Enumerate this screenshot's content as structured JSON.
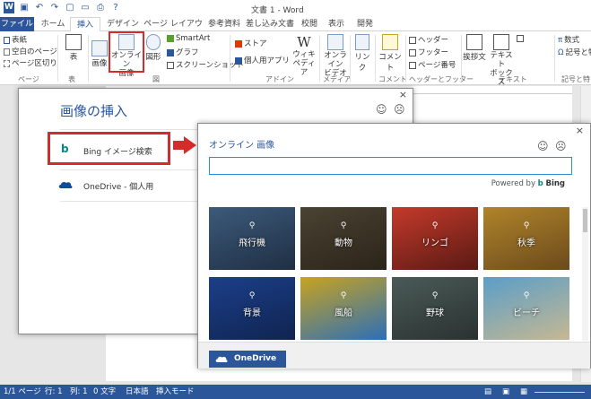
{
  "window": {
    "title": "文書 1 - Word"
  },
  "ribbon_tabs": [
    {
      "label": "ファイル",
      "state": "file"
    },
    {
      "label": "ホーム"
    },
    {
      "label": "挿入",
      "state": "active"
    },
    {
      "label": "デザイン"
    },
    {
      "label": "ページ レイアウト"
    },
    {
      "label": "参考資料"
    },
    {
      "label": "差し込み文書"
    },
    {
      "label": "校閲"
    },
    {
      "label": "表示"
    },
    {
      "label": "開発"
    }
  ],
  "ribbon": {
    "pages_group": {
      "items": [
        "表紙",
        "空白のページ",
        "ページ区切り"
      ],
      "label": "ページ"
    },
    "table_label": "表",
    "table_group_label": "表",
    "picture_label": "画像",
    "online_picture_label": "オンライン\n画像",
    "shapes_label": "図形",
    "smartart_label": "SmartArt",
    "chart_label": "グラフ",
    "screenshot_label": "スクリーンショット",
    "illustrations_group_label": "図",
    "store_label": "ストア",
    "my_apps_label": "個人用アプリ",
    "wikipedia_label": "ウィキ\nペディア",
    "apps_group_label": "アドイン",
    "online_video_label": "オンライン\nビデオ",
    "media_group_label": "メディア",
    "link_label": "リンク",
    "comment_label": "コメント",
    "comments_group_label": "コメント",
    "header_label": "ヘッダー",
    "footer_label": "フッター",
    "page_number_label": "ページ番号",
    "header_footer_group_label": "ヘッダーとフッター",
    "greeting_label": "挨拶文",
    "textbox_label": "テキスト\nボックス",
    "text_group_label": "テキスト",
    "equation_label": "数式",
    "symbol_label": "記号と特",
    "symbols_group_label": "記号と特"
  },
  "dialog_insert_picture": {
    "title": "画像の挿入",
    "close_glyph": "×",
    "bing_logo": "b",
    "bing_label": "Bing イメージ検索",
    "onedrive_label": "OneDrive - 個人用"
  },
  "dialog_online_picture": {
    "title": "オンライン 画像",
    "close_glyph": "×",
    "search_value": "",
    "powered_by": "Powered by",
    "bing_brand": "Bing",
    "onedrive_button": "OneDrive",
    "tiles": [
      {
        "label": "飛行機",
        "color_top": "#3c5a7a",
        "color_bottom": "#1f2f44"
      },
      {
        "label": "動物",
        "color_top": "#4a4232",
        "color_bottom": "#2b2419"
      },
      {
        "label": "リンゴ",
        "color_top": "#c43a2a",
        "color_bottom": "#5a1a14"
      },
      {
        "label": "秋季",
        "color_top": "#b0842a",
        "color_bottom": "#6b4a1c"
      },
      {
        "label": "背景",
        "color_top": "#1c3f8a",
        "color_bottom": "#0f2450"
      },
      {
        "label": "風船",
        "color_top": "#c8a31f",
        "color_bottom": "#2c6fb8"
      },
      {
        "label": "野球",
        "color_top": "#4a5a58",
        "color_bottom": "#2a3230"
      },
      {
        "label": "ビーチ",
        "color_top": "#5a9ec8",
        "color_bottom": "#c6b892"
      }
    ]
  },
  "statusbar": {
    "page": "1/1 ページ",
    "line": "行: 1",
    "col": "列: 1",
    "chars": "0 文字",
    "lang": "日本語",
    "mode": "挿入モード"
  },
  "colors": {
    "word_blue": "#2b579a",
    "highlight_red": "#d62b2b"
  }
}
